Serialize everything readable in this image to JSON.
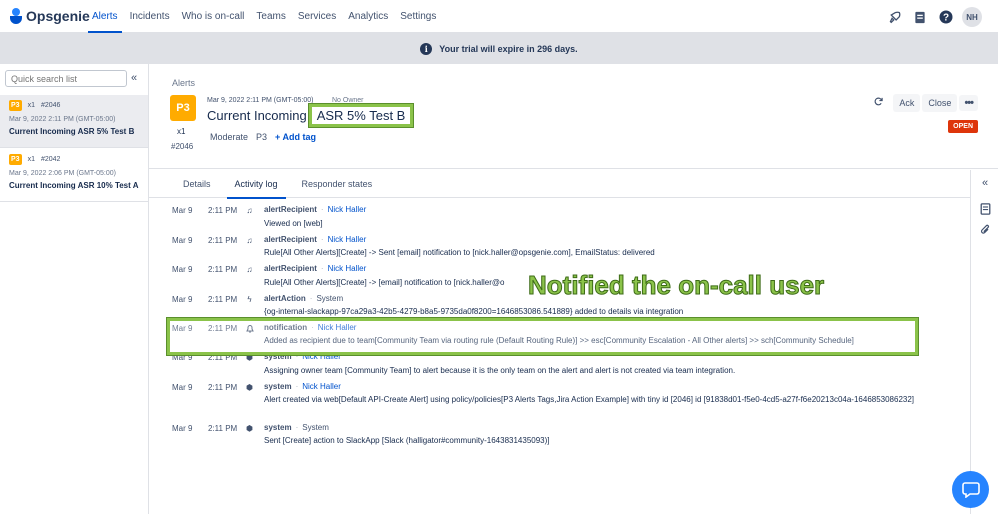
{
  "app": {
    "brand": "Opsgenie",
    "nav": [
      "Alerts",
      "Incidents",
      "Who is on-call",
      "Teams",
      "Services",
      "Analytics",
      "Settings"
    ],
    "active_nav": "Alerts",
    "user_initials": "NH",
    "icons": [
      "rocket-icon",
      "notes-icon",
      "help-icon"
    ]
  },
  "banner": {
    "text": "Your trial will expire in 296 days.",
    "icon": "info-icon"
  },
  "alert_list": {
    "search_placeholder": "Quick search list",
    "items": [
      {
        "priority": "P3",
        "count": "x1",
        "tiny_id": "#2046",
        "time": "Mar 9, 2022 2:11 PM (GMT-05:00)",
        "title": "Current Incoming ASR 5% Test B",
        "selected": true
      },
      {
        "priority": "P3",
        "count": "x1",
        "tiny_id": "#2042",
        "time": "Mar 9, 2022 2:06 PM (GMT-05:00)",
        "title": "Current Incoming ASR 10% Test A",
        "selected": false
      }
    ]
  },
  "alert": {
    "breadcrumb": "Alerts",
    "priority": "P3",
    "count": "x1",
    "tiny_id": "#2046",
    "time": "Mar 9, 2022 2:11 PM (GMT-05:00)",
    "owner": "No Owner",
    "title_prefix": "Current Incoming",
    "title_highlight": "ASR 5% Test B",
    "severity": "Moderate",
    "priority_tag": "P3",
    "add_tag_label": "+ Add tag",
    "actions": {
      "ack": "Ack",
      "close": "Close"
    },
    "status": "OPEN",
    "status_color": "#de350b",
    "priority_color": "#ffab00"
  },
  "tabs": [
    "Details",
    "Activity log",
    "Responder states"
  ],
  "active_tab": "Activity log",
  "activity_log": [
    {
      "date": "Mar 9",
      "time": "2:11 PM",
      "icon": "user-icon",
      "type": "alertRecipient",
      "actor": "Nick Haller",
      "message": "Viewed on [web]"
    },
    {
      "date": "Mar 9",
      "time": "2:11 PM",
      "icon": "user-icon",
      "type": "alertRecipient",
      "actor": "Nick Haller",
      "message": "Rule[All Other Alerts][Create] -> Sent [email] notification to [nick.haller@opsgenie.com], EmailStatus: delivered"
    },
    {
      "date": "Mar 9",
      "time": "2:11 PM",
      "icon": "user-icon",
      "type": "alertRecipient",
      "actor": "Nick Haller",
      "message": "Rule[All Other Alerts][Create] -> [email] notification to [nick.haller@o"
    },
    {
      "date": "Mar 9",
      "time": "2:11 PM",
      "icon": "lightning-icon",
      "type": "alertAction",
      "actor": "System",
      "message": "{og-internal-slackapp-97ca29a3-42b5-4279-b8a5-9735da0f8200=1646853086.541889} added to details via integration"
    },
    {
      "date": "Mar 9",
      "time": "2:11 PM",
      "icon": "bell-icon",
      "type": "notification",
      "actor": "Nick Haller",
      "message": "Added as recipient due to team[Community Team via routing rule (Default Routing Rule)] >> esc[Community Escalation - All Other alerts] >> sch[Community Schedule]"
    },
    {
      "date": "Mar 9",
      "time": "2:11 PM",
      "icon": "system-icon",
      "type": "system",
      "actor": "Nick Haller",
      "message": "Assigning owner team [Community Team] to alert because it is the only team on the alert and alert is not created via team integration."
    },
    {
      "date": "Mar 9",
      "time": "2:11 PM",
      "icon": "system-icon",
      "type": "system",
      "actor": "Nick Haller",
      "message": "Alert created via web[Default API-Create Alert] using policy/policies[P3 Alerts Tags,Jira Action Example] with tiny id [2046] id [91838d01-f5e0-4cd5-a27f-f6e20213c04a-1646853086232]"
    },
    {
      "date": "Mar 9",
      "time": "2:11 PM",
      "icon": "system-icon",
      "type": "system",
      "actor": "System",
      "message": "Sent [Create] action to SlackApp [Slack (halligator#community-1643831435093)]"
    }
  ],
  "annotation": {
    "label": "Notified the on-call user",
    "color": "#8bc34a"
  },
  "right_rail": [
    "expand-icon",
    "notes-icon",
    "attachment-icon"
  ]
}
